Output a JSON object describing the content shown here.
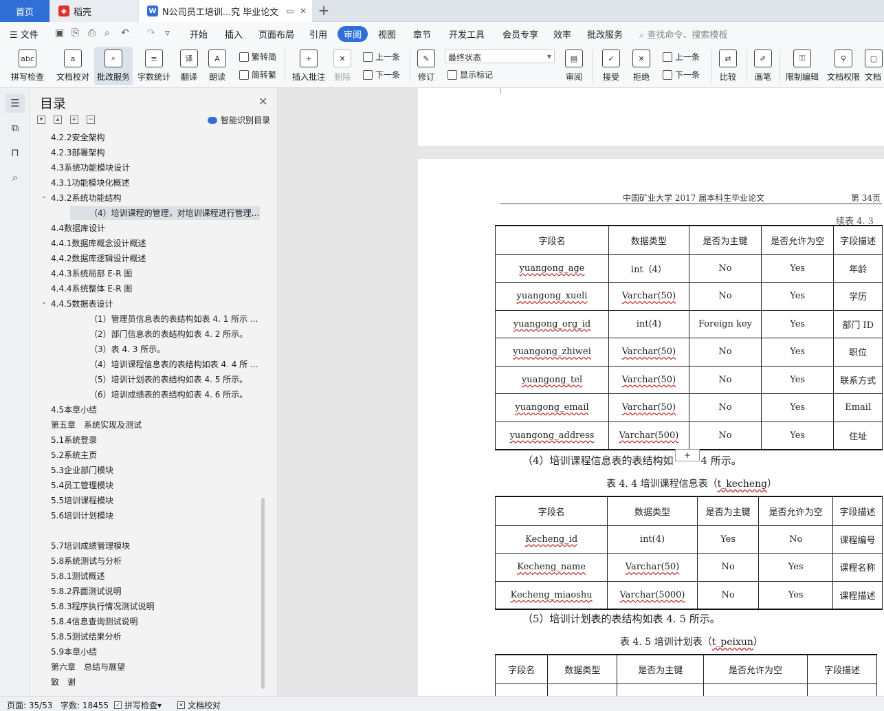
{
  "tabs": {
    "home": "首页",
    "daoke": "稻壳",
    "doc": "N公司员工培训...究 毕业论文"
  },
  "menu": {
    "file": "文件",
    "items": [
      "开始",
      "插入",
      "页面布局",
      "引用",
      "审阅",
      "视图",
      "章节",
      "开发工具",
      "会员专享",
      "效率",
      "批改服务"
    ],
    "search": "查找命令、搜索模板"
  },
  "ribbon": {
    "spell": "拼写检查",
    "proof": "文档校对",
    "correct": "批改服务",
    "wordcount": "字数统计",
    "translate": "翻译",
    "read": "朗读",
    "trad": "繁转简",
    "simp": "简转繁",
    "insert_comment": "插入批注",
    "delete": "删除",
    "prev": "上一条",
    "next": "下一条",
    "revise": "修订",
    "status": "最终状态",
    "show_marks": "显示标记",
    "review": "审阅",
    "accept": "接受",
    "reject": "拒绝",
    "prev2": "上一条",
    "next2": "下一条",
    "compare": "比较",
    "pen": "画笔",
    "restrict": "限制编辑",
    "doc_rights": "文档权限",
    "doc_more": "文档"
  },
  "toc": {
    "title": "目录",
    "smart": "智能识别目录",
    "items": [
      {
        "text": "4.2.2安全架构",
        "level": 1
      },
      {
        "text": "4.2.3部署架构",
        "level": 1
      },
      {
        "text": "4.3系统功能模块设计",
        "level": 1
      },
      {
        "text": "4.3.1功能模块化概述",
        "level": 1
      },
      {
        "text": "4.3.2系统功能结构",
        "level": 1,
        "expanded": true
      },
      {
        "text": "（4）培训课程的管理，对培训课程进行管理 ...",
        "level": 3,
        "selected": true
      },
      {
        "text": "4.4数据库设计",
        "level": 1
      },
      {
        "text": "4.4.1数据库概念设计概述",
        "level": 1
      },
      {
        "text": "4.4.2数据库逻辑设计概述",
        "level": 1
      },
      {
        "text": "4.4.3系统局部 E-R 图",
        "level": 1
      },
      {
        "text": "4.4.4系统整体 E-R 图",
        "level": 1
      },
      {
        "text": "4.4.5数据表设计",
        "level": 1,
        "expanded": true
      },
      {
        "text": "（1）管理员信息表的表结构如表 4. 1 所示 ...",
        "level": 3
      },
      {
        "text": "（2）部门信息表的表结构如表 4. 2 所示。",
        "level": 3
      },
      {
        "text": "（3）表 4. 3 所示。",
        "level": 3
      },
      {
        "text": "（4）培训课程信息表的表结构如表 4. 4 所 ...",
        "level": 3
      },
      {
        "text": "（5）培训计划表的表结构如表 4. 5 所示。",
        "level": 3
      },
      {
        "text": "（6）培训成绩表的表结构如表 4. 6 所示。",
        "level": 3
      },
      {
        "text": "4.5本章小结",
        "level": 1
      },
      {
        "text": "第五章　系统实现及测试",
        "level": 1
      },
      {
        "text": "5.1系统登录",
        "level": 1
      },
      {
        "text": "5.2系统主页",
        "level": 1
      },
      {
        "text": "5.3企业部门模块",
        "level": 1
      },
      {
        "text": "5.4员工管理模块",
        "level": 1
      },
      {
        "text": "5.5培训课程模块",
        "level": 1
      },
      {
        "text": "5.6培训计划模块",
        "level": 1
      },
      {
        "text": "",
        "level": 1
      },
      {
        "text": "5.7培训成绩管理模块",
        "level": 1
      },
      {
        "text": "5.8系统测试与分析",
        "level": 1
      },
      {
        "text": "5.8.1测试概述",
        "level": 1
      },
      {
        "text": "5.8.2界面测试说明",
        "level": 1
      },
      {
        "text": "5.8.3程序执行情况测试说明",
        "level": 1
      },
      {
        "text": "5.8.4信息查询测试说明",
        "level": 1
      },
      {
        "text": "5.8.5测试结果分析",
        "level": 1
      },
      {
        "text": "5.9本章小结",
        "level": 1
      },
      {
        "text": "第六章　总结与展望",
        "level": 1
      },
      {
        "text": "致　谢",
        "level": 1
      }
    ]
  },
  "doc": {
    "header_title": "中国矿业大学 2017 届本科生毕业论文",
    "header_page": "第 34页",
    "continued": "续表 4. 3",
    "table_headers": [
      "字段名",
      "数据类型",
      "是否为主键",
      "是否允许为空",
      "字段描述"
    ],
    "table1_rows": [
      [
        "yuangong_age",
        "int（4）",
        "No",
        "Yes",
        "年龄"
      ],
      [
        "yuangong_xueli",
        "Varchar(50)",
        "No",
        "Yes",
        "学历"
      ],
      [
        "yuangong_org_id",
        "int(4)",
        "Foreign key",
        "Yes",
        "部门 ID"
      ],
      [
        "yuangong_zhiwei",
        "Varchar(50)",
        "No",
        "Yes",
        "职位"
      ],
      [
        "yuangong_tel",
        "Varchar(50)",
        "No",
        "Yes",
        "联系方式"
      ],
      [
        "yuangong_email",
        "Varchar(50)",
        "No",
        "Yes",
        "Email"
      ],
      [
        "yuangong_address",
        "Varchar(500)",
        "No",
        "Yes",
        "住址"
      ]
    ],
    "para4_a": "（4）培训课程信息表的表结构如",
    "para4_b": "4 所示。",
    "caption4_a": "表 4. 4 培训课程信息表（",
    "caption4_b": "t_kecheng",
    "caption4_c": "）",
    "table2_rows": [
      [
        "Kecheng_id",
        "int(4)",
        "Yes",
        "No",
        "课程编号"
      ],
      [
        "Kecheng_name",
        "Varchar(50)",
        "No",
        "Yes",
        "课程名称"
      ],
      [
        "Kecheng_miaoshu",
        "Varchar(5000)",
        "No",
        "Yes",
        "课程描述"
      ]
    ],
    "para5": "（5）培训计划表的表结构如表 4. 5 所示。",
    "caption5_a": "表 4. 5 培训计划表（",
    "caption5_b": "t_peixun",
    "caption5_c": "）"
  },
  "statusbar": {
    "page": "页面: 35/53",
    "words": "字数: 18455",
    "spell": "拼写检查",
    "proof": "文档校对"
  }
}
